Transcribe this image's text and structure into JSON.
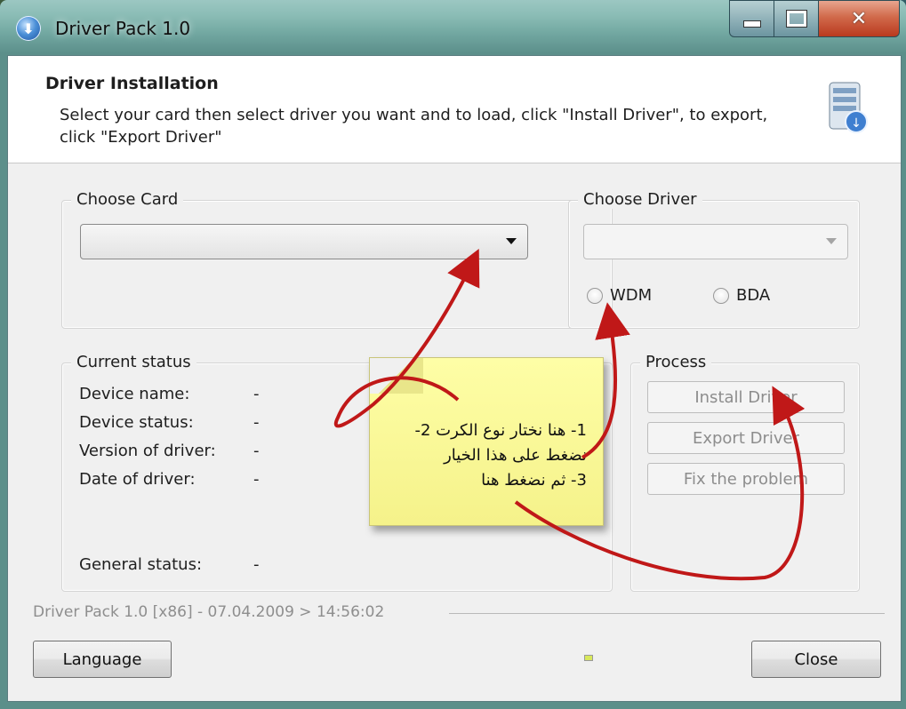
{
  "window": {
    "title": "Driver Pack 1.0"
  },
  "header": {
    "title": "Driver Installation",
    "description": "Select your card then select driver you want and to load, click \"Install Driver\", to export, click \"Export Driver\""
  },
  "choose_card": {
    "legend": "Choose Card",
    "value": ""
  },
  "choose_driver": {
    "legend": "Choose Driver",
    "value": "",
    "radios": [
      {
        "label": "WDM",
        "checked": false
      },
      {
        "label": "BDA",
        "checked": false
      }
    ]
  },
  "current_status": {
    "legend": "Current status",
    "rows": [
      {
        "label": "Device name:",
        "value": "-"
      },
      {
        "label": "Device status:",
        "value": "-"
      },
      {
        "label": "Version of driver:",
        "value": "-"
      },
      {
        "label": "Date of driver:",
        "value": "-"
      }
    ],
    "general": {
      "label": "General status:",
      "value": "-"
    }
  },
  "process": {
    "legend": "Process",
    "buttons": [
      {
        "label": "Install Driver",
        "enabled": false
      },
      {
        "label": "Export Driver",
        "enabled": false
      },
      {
        "label": "Fix the problem",
        "enabled": false
      }
    ]
  },
  "footer": {
    "info": "Driver Pack 1.0 [x86] - 07.04.2009 > 14:56:02",
    "language_button": "Language",
    "close_button": "Close"
  },
  "annotation": {
    "lines": [
      "1- هنا نختار نوع الكرت 2-",
      "نضغط على هذا الخيار",
      "3- ثم نضغط هنا"
    ],
    "arrow_color": "#c01818",
    "note_color": "#fbf99a"
  }
}
